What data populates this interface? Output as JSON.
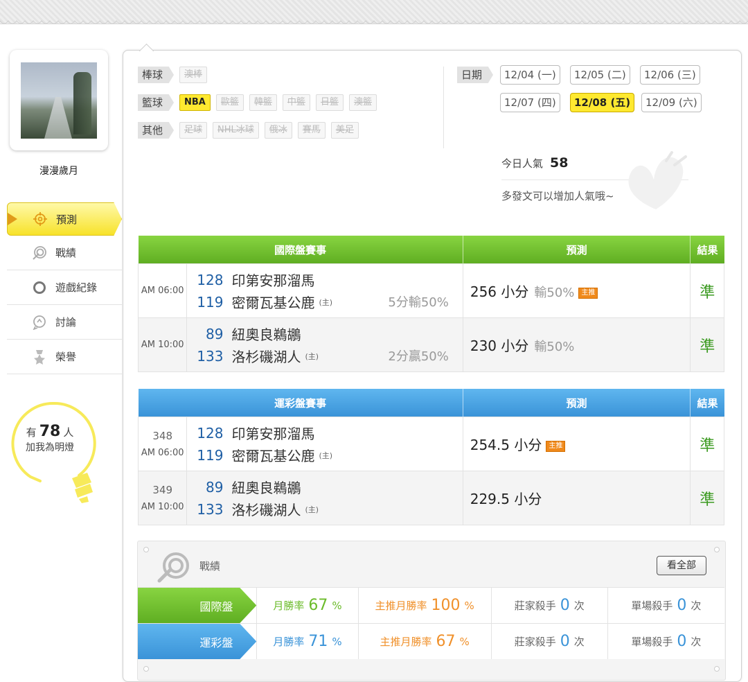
{
  "profile": {
    "name": "漫漫歲月"
  },
  "nav": [
    "預測",
    "戰績",
    "遊戲紀錄",
    "討論",
    "榮譽"
  ],
  "bulb": {
    "prefix": "有",
    "count": "78",
    "suffix": "人",
    "sub": "加我為明燈"
  },
  "categories": {
    "baseball": {
      "label": "棒球",
      "tags": [
        "澳棒"
      ]
    },
    "basketball": {
      "label": "籃球",
      "tags": [
        "NBA",
        "歐籃",
        "韓籃",
        "中籃",
        "日籃",
        "澳籃"
      ]
    },
    "other": {
      "label": "其他",
      "tags": [
        "足球",
        "NHL冰球",
        "俄冰",
        "賽馬",
        "美足"
      ]
    }
  },
  "dates": {
    "label": "日期",
    "items": [
      "12/04 (一)",
      "12/05 (二)",
      "12/06 (三)",
      "12/07 (四)",
      "12/08 (五)",
      "12/09 (六)"
    ],
    "selected": "12/08 (五)"
  },
  "popularity": {
    "label": "今日人氣",
    "value": "58",
    "message": "多發文可以增加人氣哦~"
  },
  "intl": {
    "headers": [
      "國際盤賽事",
      "預測",
      "結果"
    ],
    "rows": [
      {
        "time": "AM 06:00",
        "t1_no": "128",
        "t1": "印第安那溜馬",
        "t2_no": "119",
        "t2": "密爾瓦基公鹿",
        "host": "(主)",
        "spread": "5分輸50%",
        "pred": "256 小分",
        "loss": "輸50%",
        "badge": "主推",
        "result": "準"
      },
      {
        "time": "AM 10:00",
        "t1_no": "89",
        "t1": "紐奧良鵜鶘",
        "t2_no": "133",
        "t2": "洛杉磯湖人",
        "host": "(主)",
        "spread": "2分贏50%",
        "pred": "230 小分",
        "loss": "輸50%",
        "result": "準"
      }
    ]
  },
  "lottery": {
    "headers": [
      "運彩盤賽事",
      "預測",
      "結果"
    ],
    "rows": [
      {
        "no": "348",
        "time": "AM 06:00",
        "t1_no": "128",
        "t1": "印第安那溜馬",
        "t2_no": "119",
        "t2": "密爾瓦基公鹿",
        "host": "(主)",
        "pred": "254.5 小分",
        "badge": "主推",
        "result": "準"
      },
      {
        "no": "349",
        "time": "AM 10:00",
        "t1_no": "89",
        "t1": "紐奧良鵜鶘",
        "t2_no": "133",
        "t2": "洛杉磯湖人",
        "host": "(主)",
        "pred": "229.5 小分",
        "result": "準"
      }
    ]
  },
  "record": {
    "title": "戰績",
    "see_all": "看全部",
    "rows": [
      {
        "name": "國際盤",
        "monthly_label": "月勝率",
        "monthly": "67",
        "main_label": "主推月勝率",
        "main": "100",
        "pct": "%",
        "bank_label": "莊家殺手",
        "bank": "0",
        "single_label": "單場殺手",
        "single": "0",
        "unit": "次"
      },
      {
        "name": "運彩盤",
        "monthly_label": "月勝率",
        "monthly": "71",
        "main_label": "主推月勝率",
        "main": "67",
        "pct": "%",
        "bank_label": "莊家殺手",
        "bank": "0",
        "single_label": "單場殺手",
        "single": "0",
        "unit": "次"
      }
    ]
  }
}
